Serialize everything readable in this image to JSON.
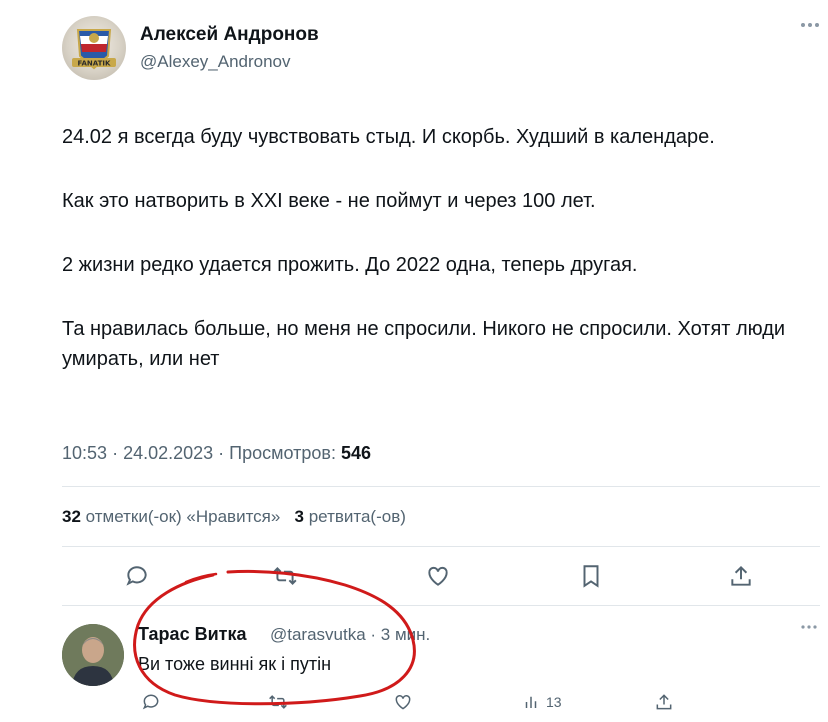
{
  "tweet": {
    "author_name": "Алексей Андронов",
    "author_handle": "@Alexey_Andronov",
    "avatar_badge_text": "FANATIK",
    "paragraphs": [
      "24.02 я всегда буду чувствовать стыд. И скорбь. Худший в календаре.",
      "Как это натворить в XXI веке - не поймут и через 100 лет.",
      "2 жизни редко удается прожить. До 2022 одна, теперь другая.",
      "Та нравилась больше, но меня не спросили. Никого не спросили. Хотят люди умирать, или нет"
    ],
    "time": "10:53",
    "date": "24.02.2023",
    "views_label": "Просмотров:",
    "views_count": "546",
    "likes_count": "32",
    "likes_label": "отметки(-ок) «Нравится»",
    "retweets_count": "3",
    "retweets_label": "ретвита(-ов)",
    "more_icon": "ellipsis-icon",
    "actions": [
      "reply-icon",
      "retweet-icon",
      "like-icon",
      "bookmark-icon",
      "share-icon"
    ]
  },
  "reply": {
    "author_name": "Тарас Витка",
    "author_handle": "@tarasvutka",
    "age": "· 3 мин.",
    "text": "Ви тоже винні як і путін",
    "views_count": "13",
    "actions": [
      "reply-icon",
      "retweet-icon",
      "like-icon",
      "views-icon",
      "share-icon"
    ]
  },
  "annotation": {
    "color": "#d01a1a",
    "shape": "hand-drawn circle around reply"
  },
  "colors": {
    "text": "#0f1419",
    "secondary": "#536471",
    "divider": "#e1e6ea"
  }
}
